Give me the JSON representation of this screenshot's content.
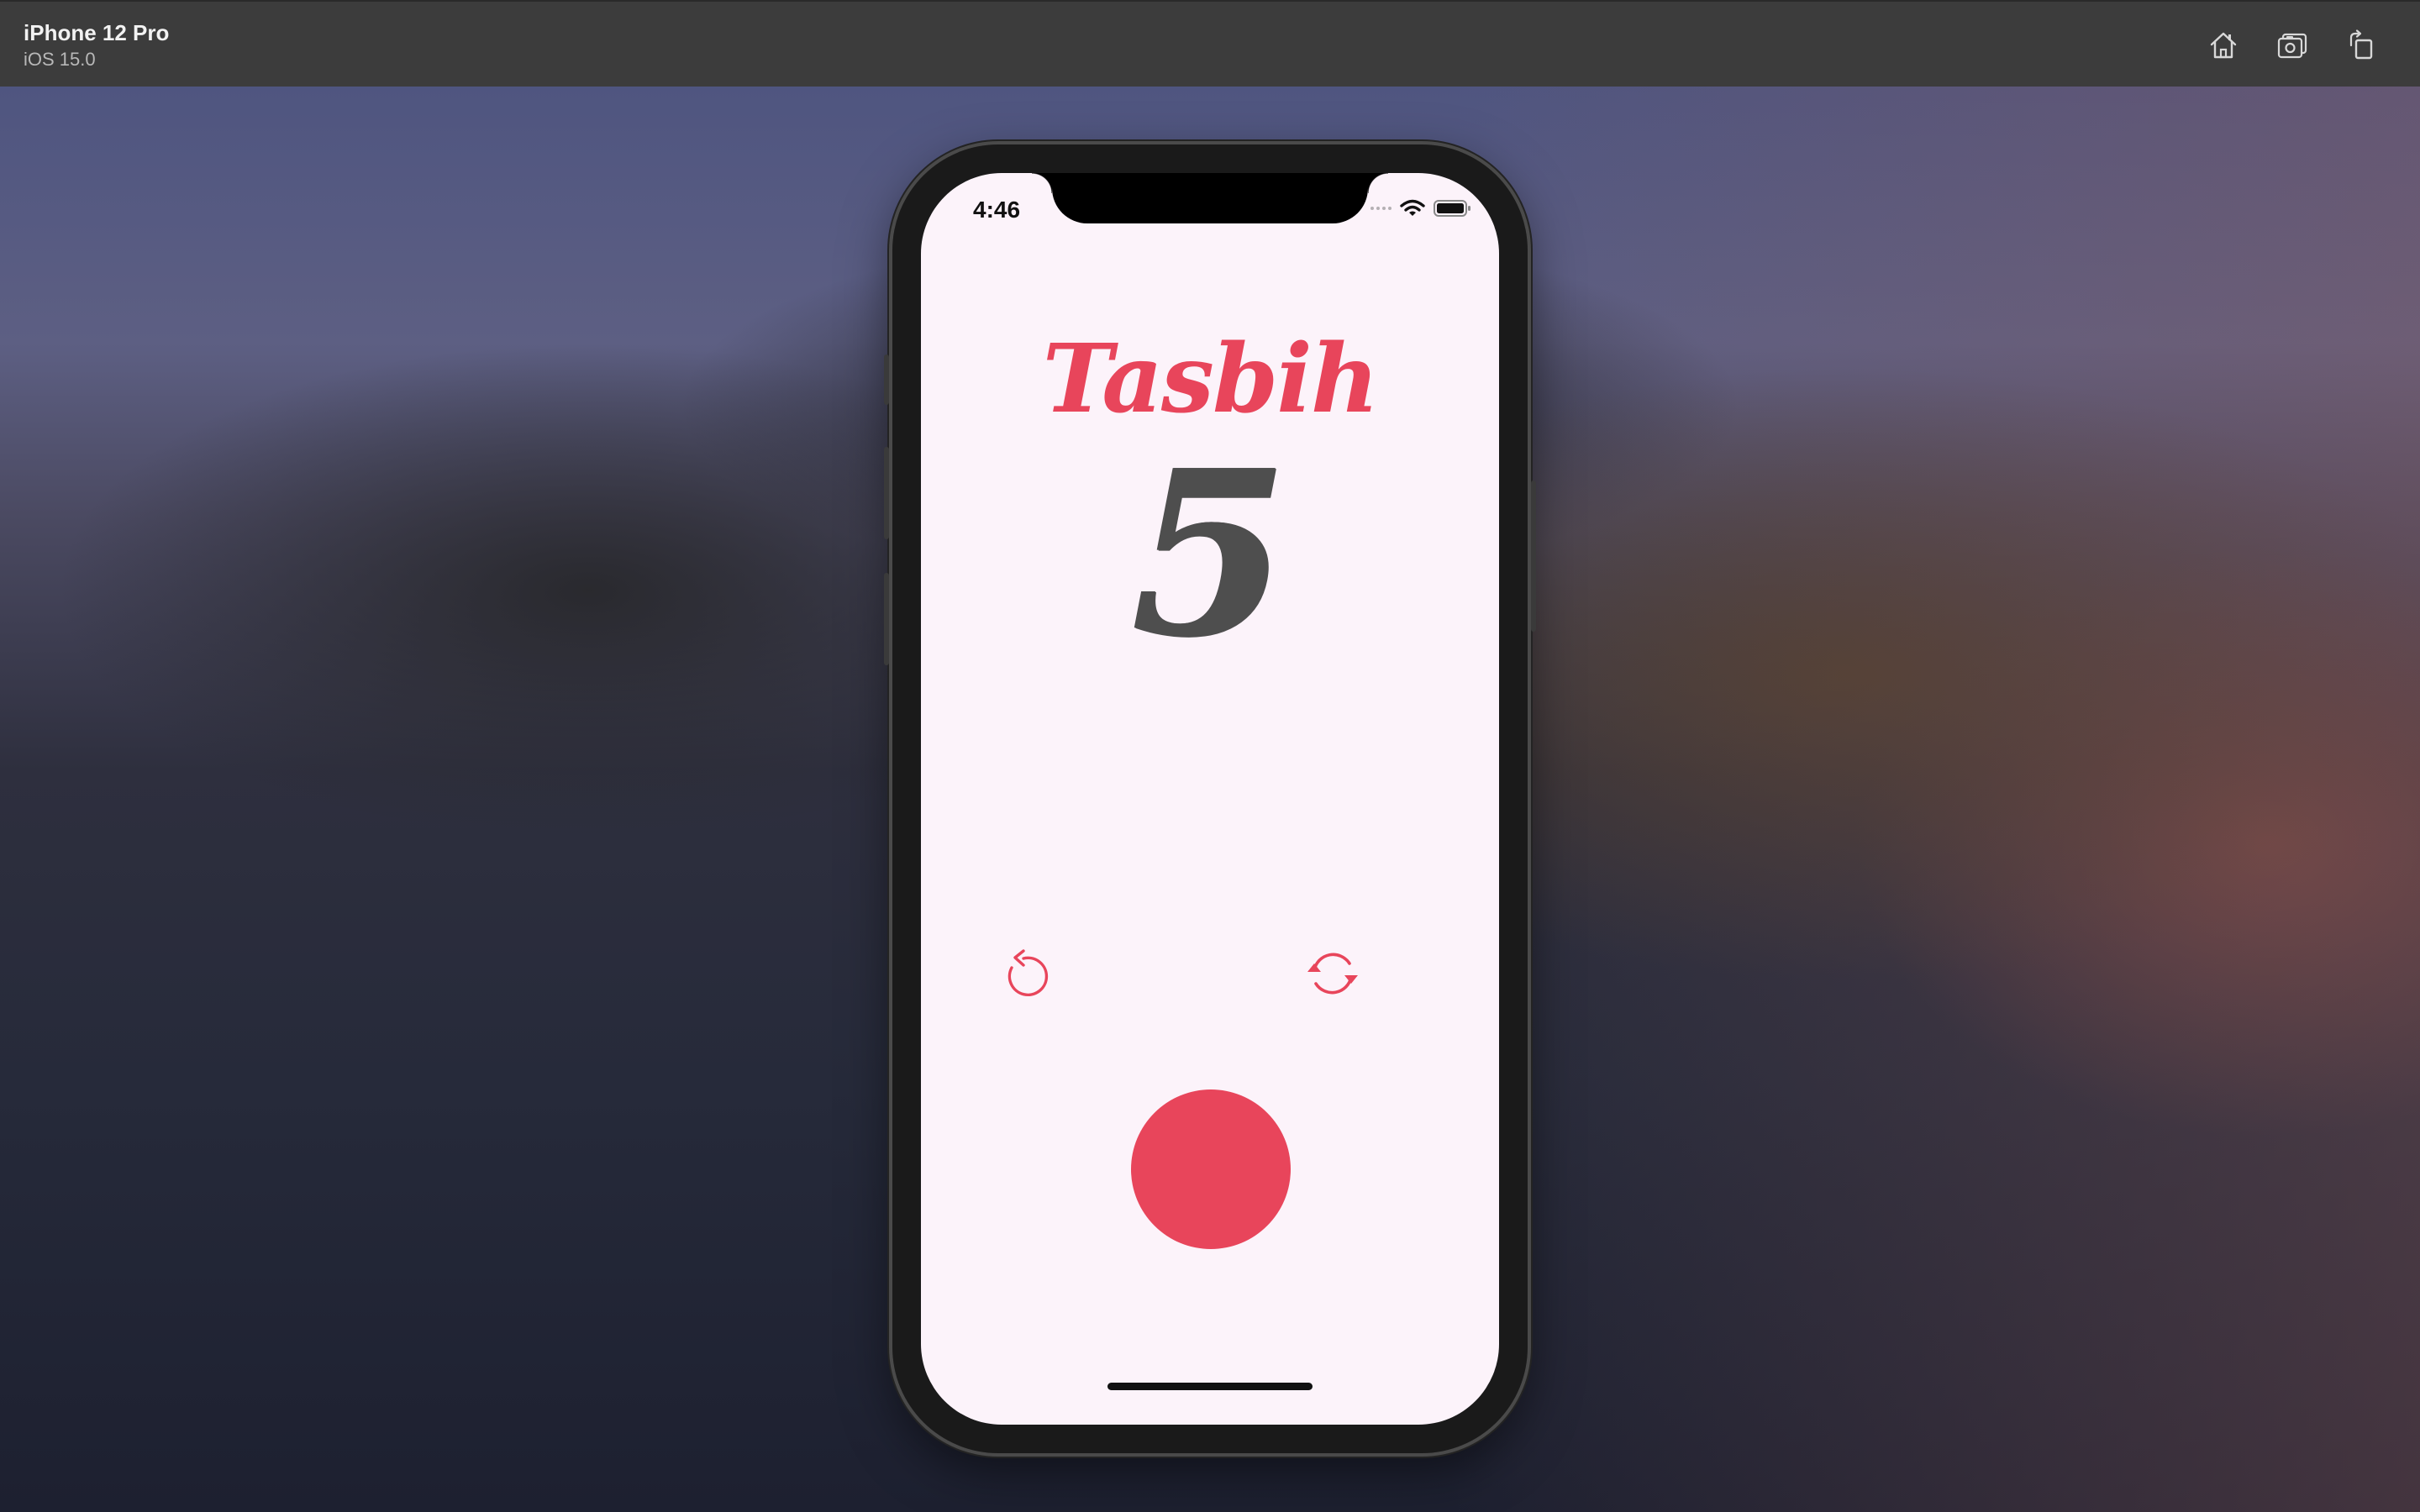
{
  "titlebar": {
    "device_name": "iPhone 12 Pro",
    "os_version": "iOS 15.0",
    "buttons": [
      {
        "name": "home-icon"
      },
      {
        "name": "screenshot-icon"
      },
      {
        "name": "rotate-icon"
      }
    ]
  },
  "status_bar": {
    "time": "4:46",
    "icons": [
      "cellular-dots",
      "wifi-icon",
      "battery-icon"
    ]
  },
  "app": {
    "title": "Tasbih",
    "count": "5",
    "undo_icon": "undo-arrow-icon",
    "reset_icon": "refresh-icon",
    "tap_button_icon": "circle"
  },
  "colors": {
    "accent": "#e8455b",
    "screen_background": "#fcf3fa",
    "counter_text": "#4e4e4e",
    "titlebar": "#3c3c3c"
  }
}
